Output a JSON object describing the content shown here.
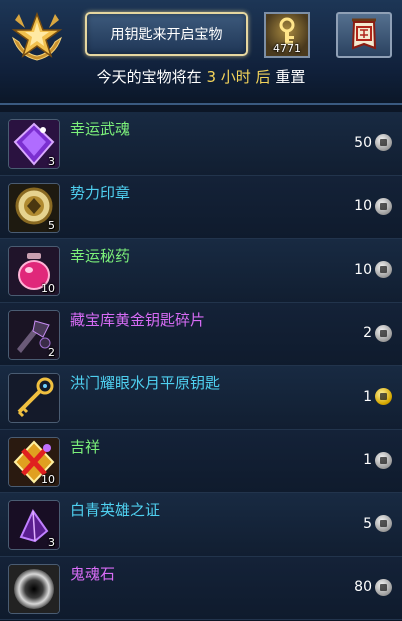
{
  "header": {
    "open_button_label": "用钥匙来开启宝物",
    "key_count": "4771",
    "reset_prefix": "今天的宝物将在",
    "reset_value": "3 小时 后",
    "reset_suffix": "重置",
    "shop_icon": "shop-sign-icon"
  },
  "items": [
    {
      "name": "幸运武魂",
      "name_color": "#7cf07a",
      "qty": "3",
      "price": "50",
      "currency": "silver",
      "icon": "purple-gem-icon"
    },
    {
      "name": "势力印章",
      "name_color": "#4fd0f0",
      "qty": "5",
      "price": "10",
      "currency": "silver",
      "icon": "gold-seal-icon"
    },
    {
      "name": "幸运秘药",
      "name_color": "#7cf07a",
      "qty": "10",
      "price": "10",
      "currency": "silver",
      "icon": "pink-potion-icon"
    },
    {
      "name": "藏宝库黄金钥匙碎片",
      "name_color": "#d76cf5",
      "qty": "2",
      "price": "2",
      "currency": "silver",
      "icon": "key-fragment-icon"
    },
    {
      "name": "洪门耀眼水月平原钥匙",
      "name_color": "#4fd0f0",
      "qty": "",
      "price": "1",
      "currency": "gold",
      "icon": "golden-key-icon"
    },
    {
      "name": "吉祥",
      "name_color": "#7cf07a",
      "qty": "10",
      "price": "1",
      "currency": "silver",
      "icon": "lucky-charm-icon"
    },
    {
      "name": "白青英雄之证",
      "name_color": "#4fd0f0",
      "qty": "3",
      "price": "5",
      "currency": "silver",
      "icon": "hero-proof-icon"
    },
    {
      "name": "鬼魂石",
      "name_color": "#d76cf5",
      "qty": "",
      "price": "80",
      "currency": "silver",
      "icon": "ghost-stone-icon"
    }
  ]
}
